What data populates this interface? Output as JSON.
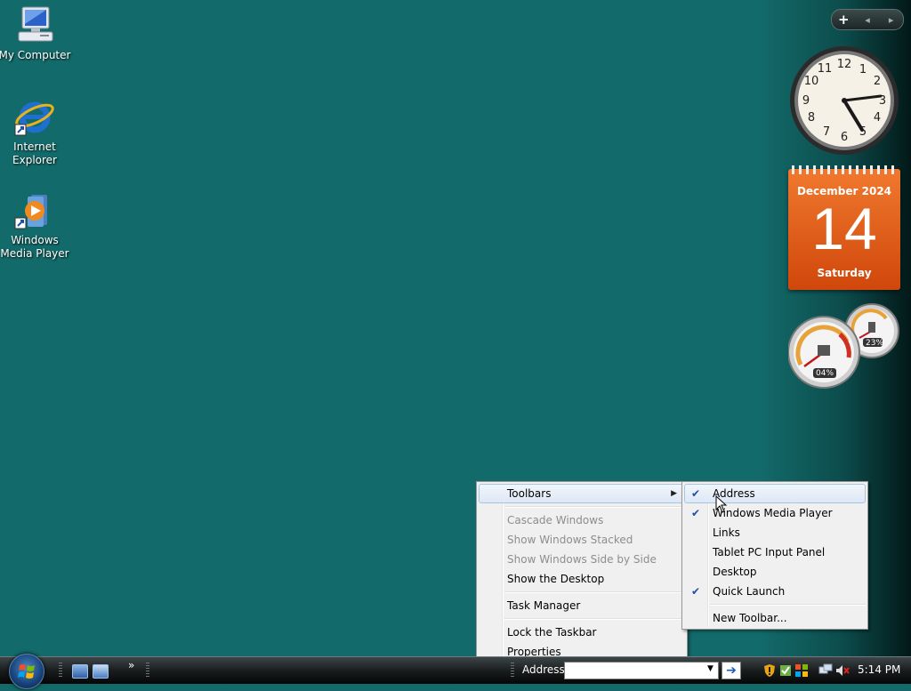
{
  "desktop": {
    "icons": [
      {
        "label": "My Computer"
      },
      {
        "label": "Internet\nExplorer"
      },
      {
        "label": "Windows\nMedia Player"
      }
    ]
  },
  "sidebar": {
    "controls": {
      "add": "+",
      "prev": "◂",
      "next": "▸"
    },
    "clock": {
      "time": "5:14 PM"
    },
    "calendar": {
      "month": "December 2024",
      "day": "14",
      "weekday": "Saturday"
    },
    "meters": {
      "cpu": "04%",
      "memory": "23%"
    }
  },
  "context_menu": {
    "items": [
      {
        "label": "Toolbars",
        "submenu": true,
        "highlighted": true
      },
      {
        "label": "Cascade Windows",
        "disabled": true
      },
      {
        "label": "Show Windows Stacked",
        "disabled": true
      },
      {
        "label": "Show Windows Side by Side",
        "disabled": true
      },
      {
        "label": "Show the Desktop"
      },
      {
        "label": "Task Manager"
      },
      {
        "label": "Lock the Taskbar"
      },
      {
        "label": "Properties"
      }
    ]
  },
  "toolbars_submenu": {
    "items": [
      {
        "label": "Address",
        "checked": true
      },
      {
        "label": "Windows Media Player",
        "checked": true
      },
      {
        "label": "Links",
        "checked": false
      },
      {
        "label": "Tablet PC Input Panel",
        "checked": false
      },
      {
        "label": "Desktop",
        "checked": false
      },
      {
        "label": "Quick Launch",
        "checked": true
      },
      {
        "label": "New Toolbar...",
        "checked": false
      }
    ],
    "check_glyph": "✔"
  },
  "taskbar": {
    "chevron": "»",
    "address_label": "Address",
    "address_value": "",
    "address_placeholder": "",
    "go_glyph": "➔",
    "time": "5:14 PM"
  },
  "colors": {
    "desktop_bg": "#136a6a",
    "calendar_orange": "#e0601a",
    "menu_bg": "#f0f0f0",
    "check_blue": "#1e4fa8"
  }
}
